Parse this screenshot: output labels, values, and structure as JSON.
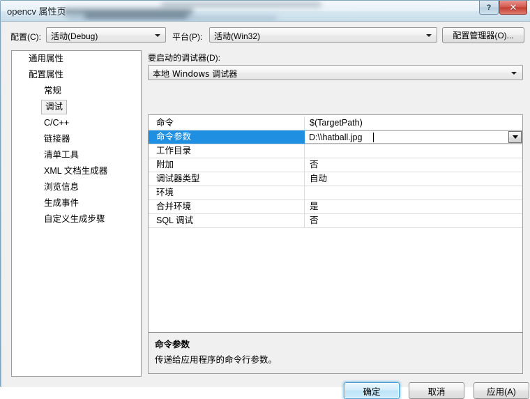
{
  "window": {
    "title": "opencv 属性页",
    "buttons": {
      "help": "?",
      "close": "✕"
    }
  },
  "config_bar": {
    "config_label": "配置(C):",
    "config_value": "活动(Debug)",
    "platform_label": "平台(P):",
    "platform_value": "活动(Win32)",
    "config_manager_button": "配置管理器(O)..."
  },
  "tree": {
    "items": [
      {
        "label": "通用属性",
        "level": 0,
        "selected": false
      },
      {
        "label": "配置属性",
        "level": 0,
        "selected": false
      },
      {
        "label": "常规",
        "level": 1,
        "selected": false
      },
      {
        "label": "调试",
        "level": 1,
        "selected": true
      },
      {
        "label": "C/C++",
        "level": 1,
        "selected": false
      },
      {
        "label": "链接器",
        "level": 1,
        "selected": false
      },
      {
        "label": "清单工具",
        "level": 1,
        "selected": false
      },
      {
        "label": "XML 文档生成器",
        "level": 1,
        "selected": false
      },
      {
        "label": "浏览信息",
        "level": 1,
        "selected": false
      },
      {
        "label": "生成事件",
        "level": 1,
        "selected": false
      },
      {
        "label": "自定义生成步骤",
        "level": 1,
        "selected": false
      }
    ]
  },
  "debugger": {
    "label": "要启动的调试器(D):",
    "value": "本地 Windows 调试器"
  },
  "grid": {
    "rows": [
      {
        "name": "命令",
        "value": "$(TargetPath)",
        "selected": false,
        "editing": false
      },
      {
        "name": "命令参数",
        "value": "D:\\\\hatball.jpg",
        "selected": true,
        "editing": true
      },
      {
        "name": "工作目录",
        "value": "",
        "selected": false,
        "editing": false
      },
      {
        "name": "附加",
        "value": "否",
        "selected": false,
        "editing": false
      },
      {
        "name": "调试器类型",
        "value": "自动",
        "selected": false,
        "editing": false
      },
      {
        "name": "环境",
        "value": "",
        "selected": false,
        "editing": false
      },
      {
        "name": "合并环境",
        "value": "是",
        "selected": false,
        "editing": false
      },
      {
        "name": "SQL 调试",
        "value": "否",
        "selected": false,
        "editing": false
      }
    ]
  },
  "description": {
    "title": "命令参数",
    "body": "传递给应用程序的命令行参数。"
  },
  "footer": {
    "ok": "确定",
    "cancel": "取消",
    "apply": "应用(A)"
  },
  "colors": {
    "selection_blue": "#1e8fe1",
    "close_red": "#c33c31",
    "accent_focus": "#4a9fd4"
  }
}
